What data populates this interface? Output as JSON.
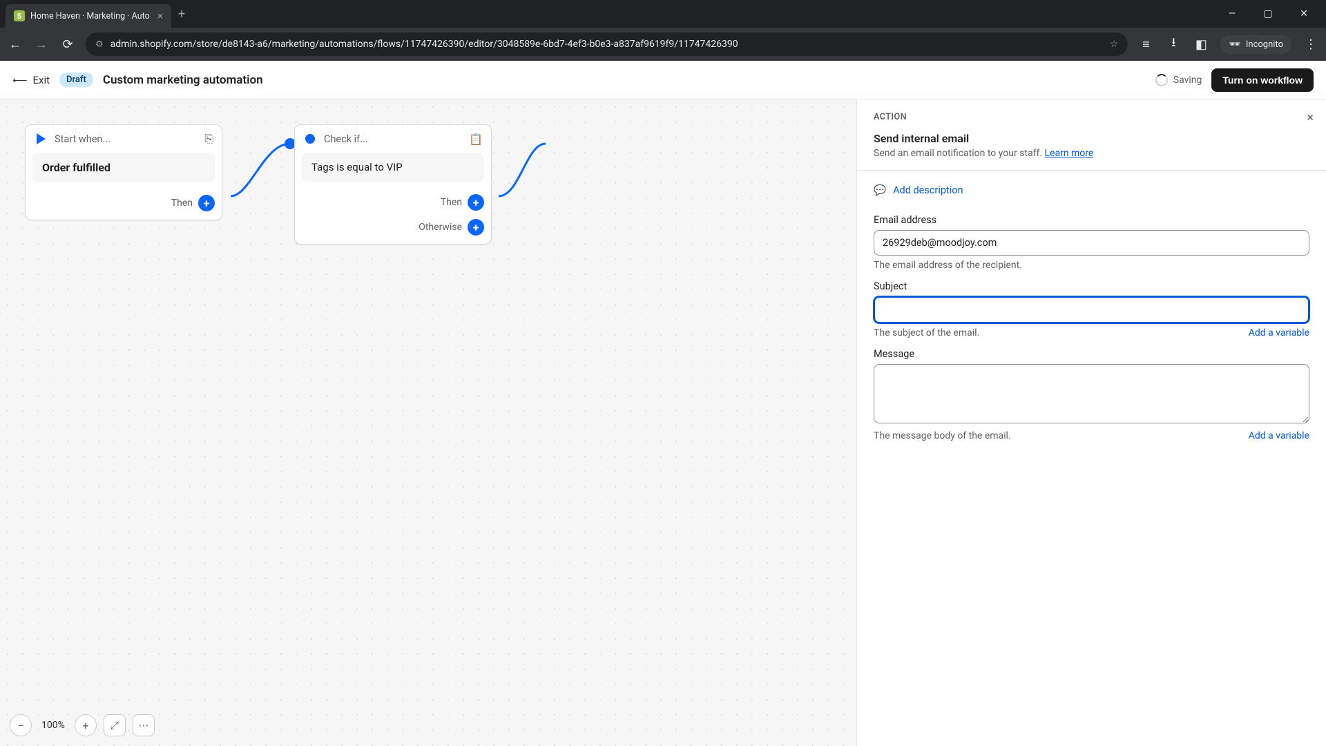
{
  "browser": {
    "tab_title": "Home Haven · Marketing · Auto",
    "url": "admin.shopify.com/store/de8143-a6/marketing/automations/flows/11747426390/editor/3048589e-6bd7-4ef3-b0e3-a837af9619f9/11747426390",
    "incognito_label": "Incognito"
  },
  "header": {
    "exit": "Exit",
    "draft_badge": "Draft",
    "title": "Custom marketing automation",
    "saving": "Saving",
    "turn_on": "Turn on workflow"
  },
  "canvas": {
    "start_node": {
      "header": "Start when...",
      "body": "Order fulfilled",
      "then": "Then"
    },
    "check_node": {
      "header": "Check if...",
      "body": "Tags is equal to VIP",
      "then": "Then",
      "otherwise": "Otherwise"
    },
    "zoom": {
      "value": "100%"
    }
  },
  "panel": {
    "eyebrow": "ACTION",
    "title": "Send internal email",
    "subtitle": "Send an email notification to your staff. ",
    "learn_more": "Learn more",
    "add_description": "Add description",
    "email": {
      "label": "Email address",
      "value": "26929deb@moodjoy.com",
      "help": "The email address of the recipient."
    },
    "subject": {
      "label": "Subject",
      "value": "",
      "help": "The subject of the email.",
      "add_var": "Add a variable"
    },
    "message": {
      "label": "Message",
      "value": "",
      "help": "The message body of the email.",
      "add_var": "Add a variable"
    }
  }
}
